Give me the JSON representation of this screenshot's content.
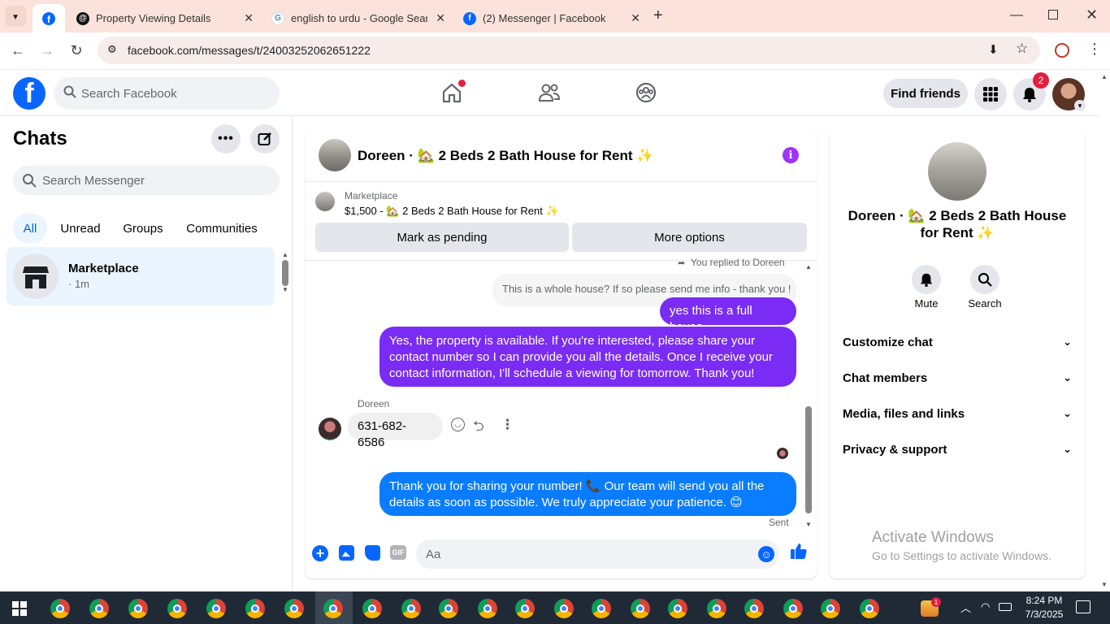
{
  "browser": {
    "tabs": [
      {
        "label": "Property Viewing Details",
        "icon": "threads-icon"
      },
      {
        "label": "english to urdu - Google Search",
        "icon": "google-icon"
      },
      {
        "label": "(2) Messenger | Facebook",
        "icon": "facebook-icon"
      }
    ],
    "url": "facebook.com/messages/t/24003252062651222"
  },
  "fb": {
    "search_placeholder": "Search Facebook",
    "find_friends": "Find friends",
    "notif_count": "2"
  },
  "chats": {
    "title": "Chats",
    "search_placeholder": "Search Messenger",
    "filters": [
      "All",
      "Unread",
      "Groups",
      "Communities"
    ],
    "items": [
      {
        "name": "Marketplace",
        "meta": "· 1m"
      }
    ]
  },
  "conversation": {
    "title": "Doreen · 🏡 2 Beds 2 Bath House for Rent ✨",
    "listing_source": "Marketplace",
    "listing_line": "$1,500 - 🏡 2 Beds 2 Bath House for Rent ✨",
    "mark_pending": "Mark as pending",
    "more_options": "More options",
    "replied_note": "You replied to Doreen",
    "quoted_message": "This is a whole house? If so please send me info - thank you !",
    "messages": [
      {
        "from": "me",
        "text": "yes this is a full house"
      },
      {
        "from": "me",
        "text": "Yes, the property is  available. If you're interested, please share your contact number so I can provide you  all the details. Once I receive your contact information, I'll   schedule a viewing for tomorrow. Thank you!"
      },
      {
        "from": "Doreen",
        "sender": "Doreen",
        "text": "631-682-6586"
      },
      {
        "from": "me",
        "text": "Thank you for sharing your number! 📞 Our team will send you all the details as soon as possible. We truly appreciate your patience. 😊"
      }
    ],
    "sent_label": "Sent",
    "composer_placeholder": "Aa"
  },
  "info": {
    "title": "Doreen · 🏡 2 Beds 2 Bath House for Rent ✨",
    "mute": "Mute",
    "search": "Search",
    "sections": [
      "Customize chat",
      "Chat members",
      "Media, files and links",
      "Privacy & support"
    ],
    "watermark_title": "Activate Windows",
    "watermark_sub": "Go to Settings to activate Windows."
  },
  "taskbar": {
    "time": "8:24 PM",
    "date": "7/3/2025",
    "weather_badge": "1"
  },
  "colors": {
    "fb_blue": "#0866ff",
    "purple_bubble": "#7a2cf4",
    "blue_bubble": "#0a7cff"
  }
}
